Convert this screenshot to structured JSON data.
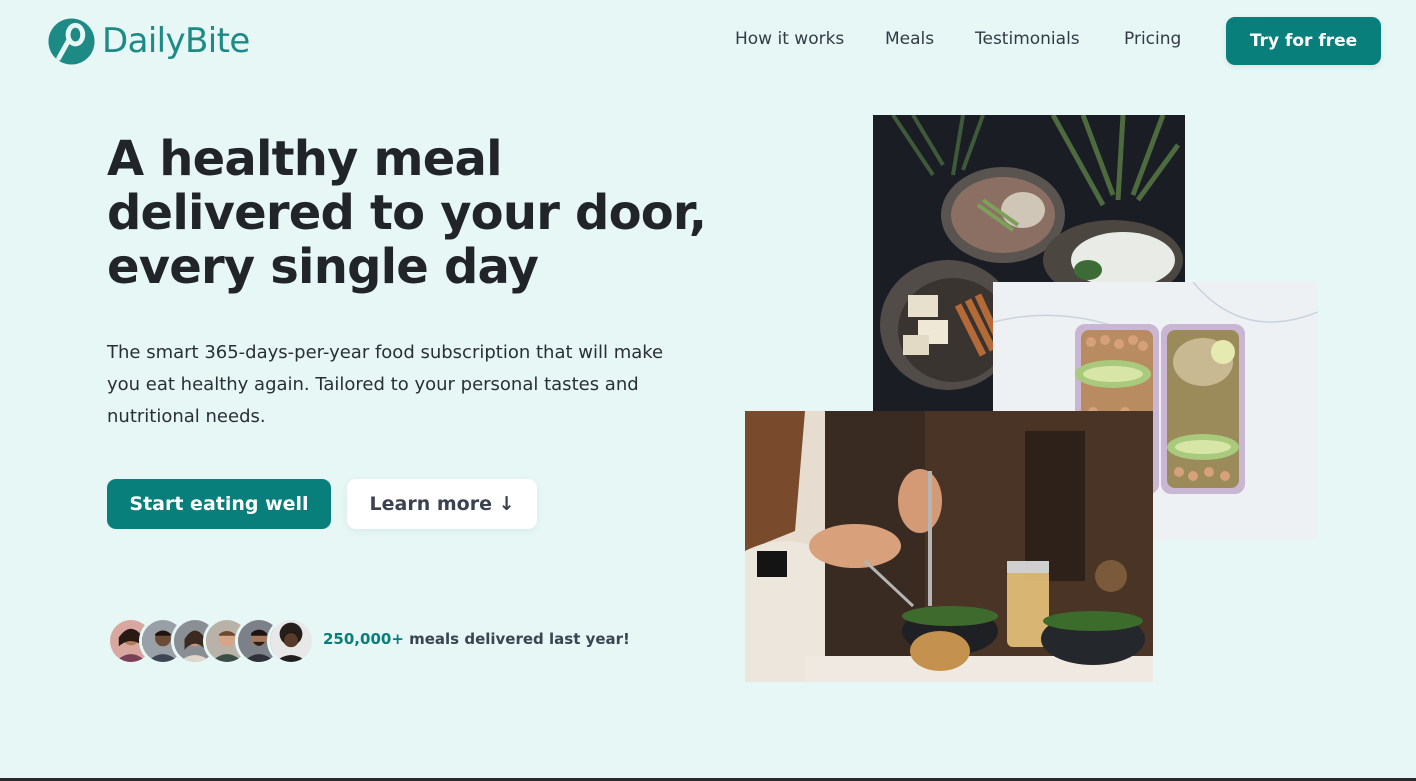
{
  "brand": {
    "name": "DailyBite",
    "accent": "#087f7b",
    "background": "#e6f7f6"
  },
  "nav": {
    "links": [
      "How it works",
      "Meals",
      "Testimonials",
      "Pricing"
    ],
    "cta": "Try for free"
  },
  "hero": {
    "title": "A healthy meal delivered to your door, every single day",
    "description": "The smart 365-days-per-year food subscription that will make you eat healthy again. Tailored to your personal tastes and nutritional needs.",
    "primary_button": "Start eating well",
    "secondary_button": "Learn more ↓"
  },
  "social_proof": {
    "highlight": "250,000+",
    "text": " meals delivered last year!"
  },
  "images": [
    {
      "name": "meal-bowls-photo",
      "icon": "photo"
    },
    {
      "name": "meal-prep-boxes-photo",
      "icon": "photo"
    },
    {
      "name": "person-eating-photo",
      "icon": "photo"
    }
  ]
}
